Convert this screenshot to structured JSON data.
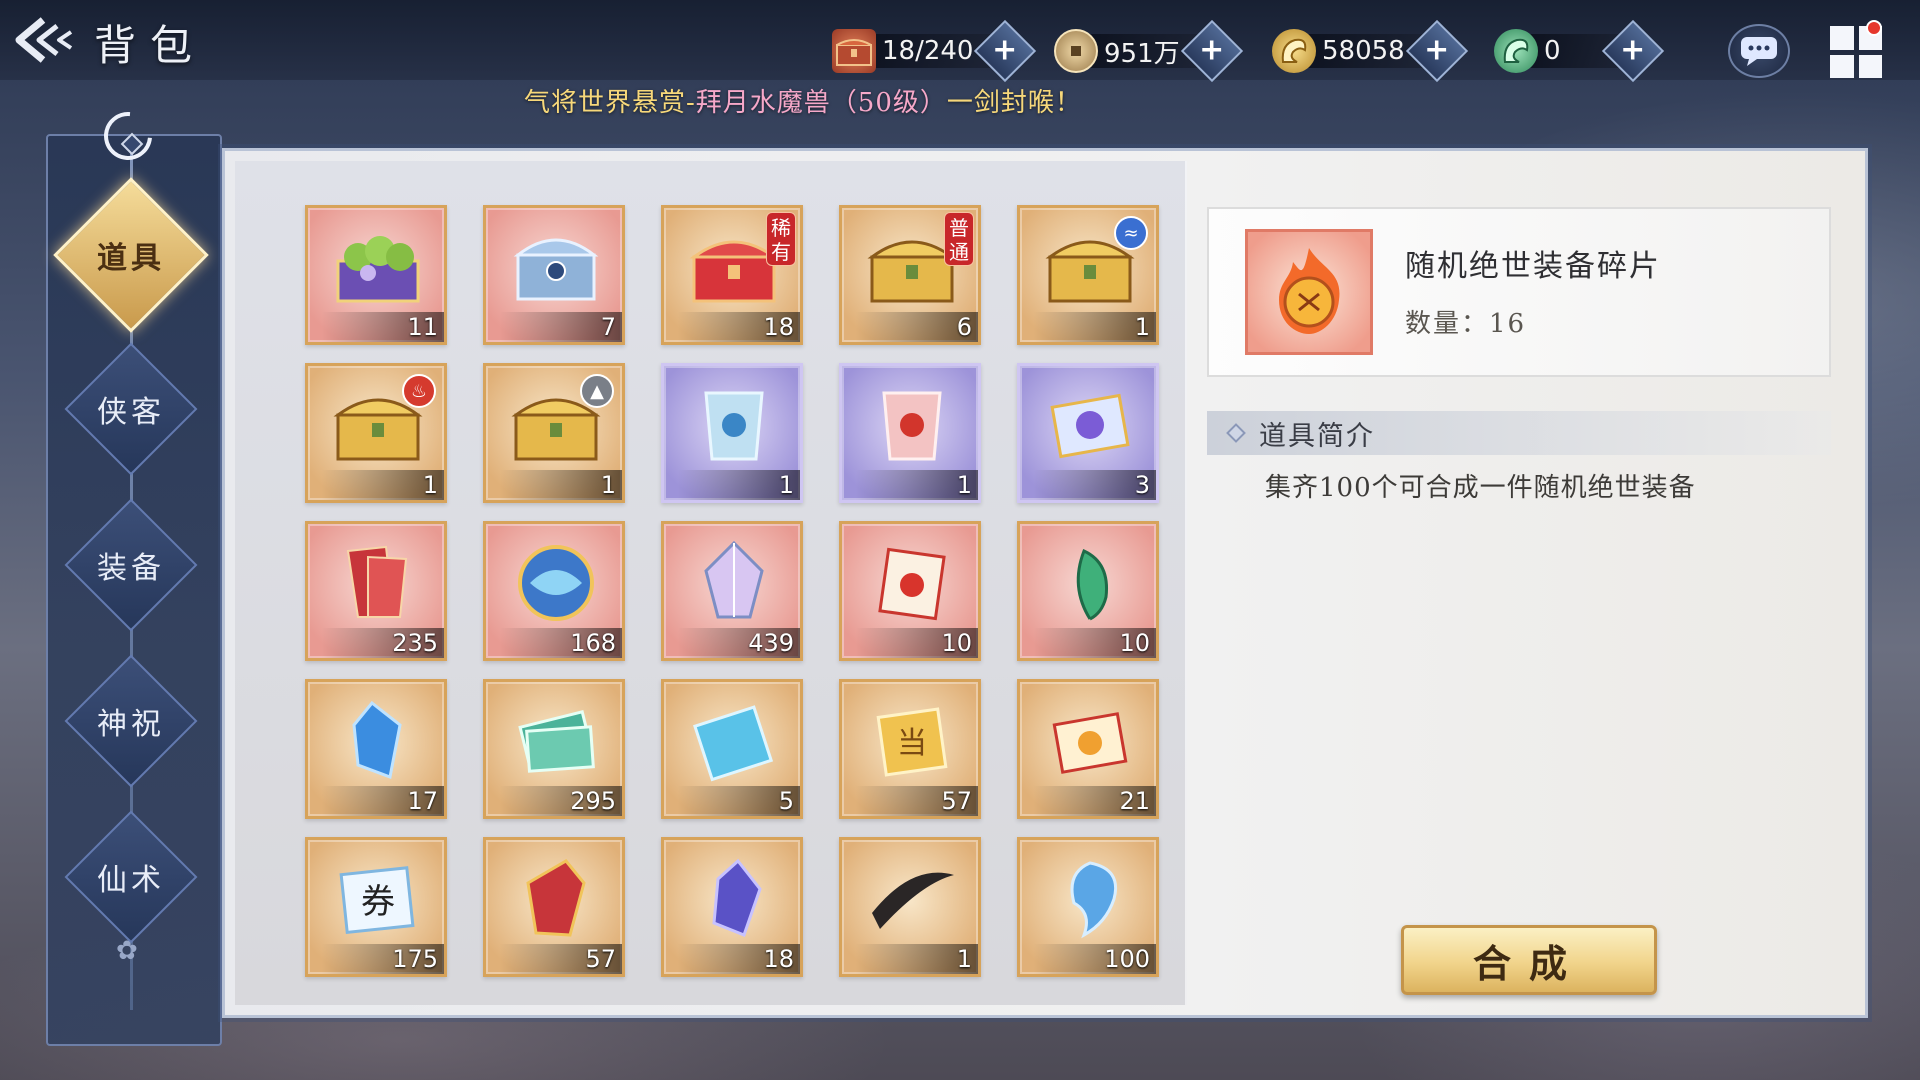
{
  "header": {
    "title": "背包",
    "resources": [
      {
        "icon": "chest-icon",
        "value": "18/240"
      },
      {
        "icon": "copper-coin-icon",
        "value": "951万"
      },
      {
        "icon": "gold-dragon-icon",
        "value": "58058"
      },
      {
        "icon": "jade-dragon-icon",
        "value": "0"
      }
    ],
    "plus": "+"
  },
  "marquee": {
    "prefix": "气将世界悬赏-",
    "highlight": "拜月水魔兽（50级）",
    "suffix": "一剑封喉！"
  },
  "nav": {
    "items": [
      {
        "label": "道具",
        "active": true
      },
      {
        "label": "侠客",
        "active": false
      },
      {
        "label": "装备",
        "active": false
      },
      {
        "label": "神祝",
        "active": false
      },
      {
        "label": "仙术",
        "active": false
      }
    ]
  },
  "inventory": {
    "items": [
      {
        "name": "fruit-basket-icon",
        "count": "11",
        "bg": "red"
      },
      {
        "name": "silver-chest-icon",
        "count": "7",
        "bg": "red"
      },
      {
        "name": "rare-red-chest-icon",
        "count": "18",
        "bg": "orange",
        "tag": "稀有"
      },
      {
        "name": "common-gold-chest-icon",
        "count": "6",
        "bg": "orange",
        "tag": "普通"
      },
      {
        "name": "water-gold-chest-icon",
        "count": "1",
        "bg": "orange"
      },
      {
        "name": "fire-gold-chest-icon",
        "count": "1",
        "bg": "orange"
      },
      {
        "name": "wind-gold-chest-icon",
        "count": "1",
        "bg": "orange"
      },
      {
        "name": "blue-talisman-icon",
        "count": "1",
        "bg": "purple"
      },
      {
        "name": "red-talisman-icon",
        "count": "1",
        "bg": "purple"
      },
      {
        "name": "purple-scroll-icon",
        "count": "3",
        "bg": "purple"
      },
      {
        "name": "red-fan-cards-icon",
        "count": "235",
        "bg": "red"
      },
      {
        "name": "spirit-orb-icon",
        "count": "168",
        "bg": "red"
      },
      {
        "name": "crystal-ore-icon",
        "count": "439",
        "bg": "red"
      },
      {
        "name": "red-scroll-icon",
        "count": "10",
        "bg": "red"
      },
      {
        "name": "jade-herb-icon",
        "count": "10",
        "bg": "red"
      },
      {
        "name": "blue-crystal-shard-icon",
        "count": "17",
        "bg": "orange"
      },
      {
        "name": "jade-notes-icon",
        "count": "295",
        "bg": "orange"
      },
      {
        "name": "blue-ticket-icon",
        "count": "5",
        "bg": "orange"
      },
      {
        "name": "gold-ticket-icon",
        "count": "57",
        "bg": "orange"
      },
      {
        "name": "gold-scroll-icon",
        "count": "21",
        "bg": "orange"
      },
      {
        "name": "voucher-icon",
        "count": "175",
        "bg": "orange"
      },
      {
        "name": "red-armor-shard-icon",
        "count": "57",
        "bg": "orange"
      },
      {
        "name": "violet-gem-icon",
        "count": "18",
        "bg": "orange"
      },
      {
        "name": "brush-stroke-icon",
        "count": "1",
        "bg": "orange"
      },
      {
        "name": "blue-spirit-icon",
        "count": "100",
        "bg": "orange"
      }
    ]
  },
  "detail": {
    "name": "随机绝世装备碎片",
    "quantity": "数量：16",
    "intro_label": "道具简介",
    "intro_text": "集齐100个可合成一件随机绝世装备",
    "compose_label": "合成"
  }
}
